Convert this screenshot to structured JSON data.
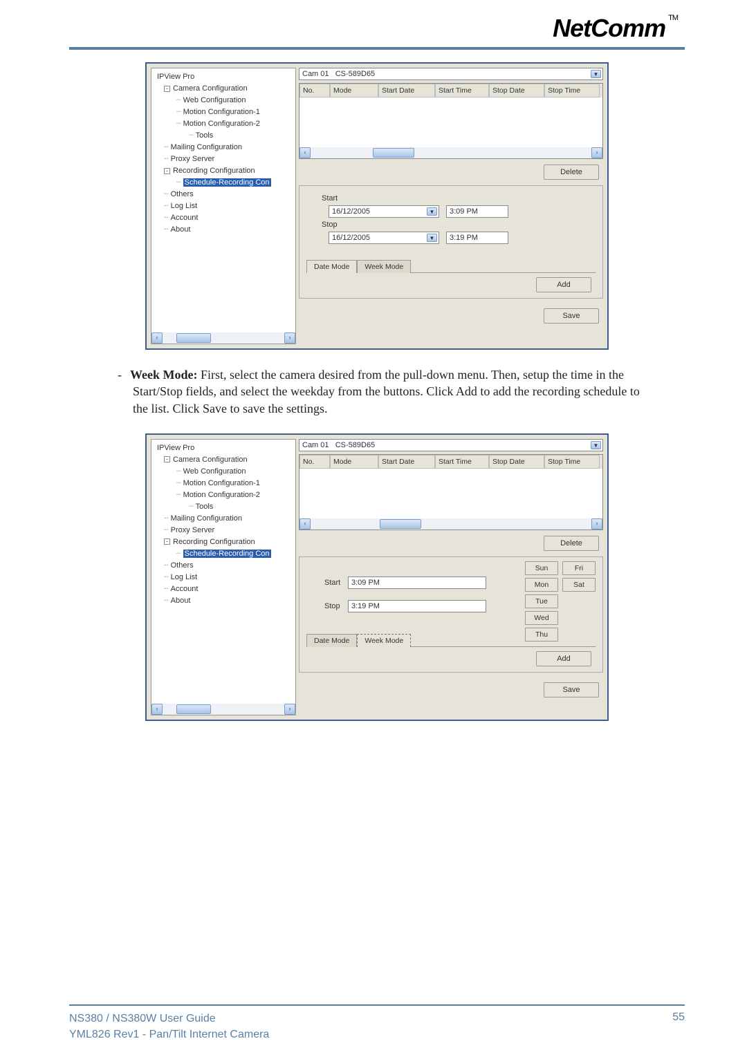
{
  "brand": {
    "name": "NetComm",
    "tm": "TM"
  },
  "tree": {
    "root": "IPView Pro",
    "camera_config": "Camera Configuration",
    "web_config": "Web Configuration",
    "motion1": "Motion Configuration-1",
    "motion2": "Motion Configuration-2",
    "tools": "Tools",
    "mailing": "Mailing Configuration",
    "proxy": "Proxy Server",
    "recording": "Recording Configuration",
    "schedule_rec": "Schedule-Recording Con",
    "others": "Others",
    "loglist": "Log List",
    "account": "Account",
    "about": "About"
  },
  "camera_selector": {
    "label": "Cam 01",
    "id": "CS-589D65"
  },
  "table_headers": {
    "no": "No.",
    "mode": "Mode",
    "start_date": "Start Date",
    "start_time": "Start Time",
    "stop_date": "Stop Date",
    "stop_time": "Stop Time"
  },
  "buttons": {
    "delete": "Delete",
    "add": "Add",
    "save": "Save",
    "date_mode": "Date Mode",
    "week_mode": "Week Mode"
  },
  "date_form": {
    "start_label": "Start",
    "start_date": "16/12/2005",
    "start_time": "3:09 PM",
    "stop_label": "Stop",
    "stop_date": "16/12/2005",
    "stop_time": "3:19 PM"
  },
  "week_form": {
    "start_label": "Start",
    "start_time": "3:09 PM",
    "stop_label": "Stop",
    "stop_time": "3:19 PM",
    "days": {
      "sun": "Sun",
      "mon": "Mon",
      "tue": "Tue",
      "wed": "Wed",
      "thu": "Thu",
      "fri": "Fri",
      "sat": "Sat"
    }
  },
  "paragraph": {
    "dash": "-",
    "bold": "Week Mode:",
    "text": " First, select the camera desired from the pull-down menu.  Then, setup the time in the Start/Stop fields, and select the weekday from the buttons.  Click Add to add the recording schedule to the list.  Click Save to save the settings."
  },
  "footer": {
    "line1": "NS380 / NS380W User Guide",
    "line2": "YML826 Rev1 - Pan/Tilt Internet Camera",
    "page": "55"
  }
}
